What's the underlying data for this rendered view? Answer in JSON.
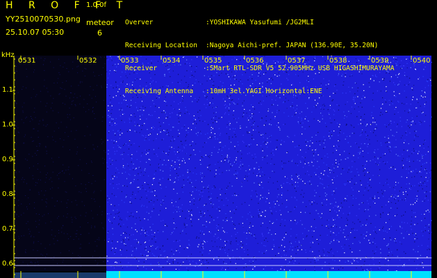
{
  "header": {
    "title": "H R O F F T",
    "version": "1.0.0f",
    "filename": "YY2510070530.png",
    "datetime": "25.10.07 05:30",
    "meteor_label": "meteor",
    "meteor_count": "6"
  },
  "station_info": [
    {
      "key": "Overver",
      "value": ":YOSHIKAWA Yasufumi /JG2MLI"
    },
    {
      "key": "Receiving Location",
      "value": ":Nagoya Aichi-pref. JAPAN (136.90E, 35.20N)"
    },
    {
      "key": "Receiver",
      "value": ":SMart RTL-SDR V5 52.905MHz USB HIGASHIMURAYAMA"
    },
    {
      "key": "Receiving Antenna",
      "value": ":10mH 3el.YAGI Horizontal:ENE"
    }
  ],
  "axis": {
    "y_unit": "kHz",
    "y_ticks": [
      "1.1",
      "1.0",
      "0.9",
      "0.8",
      "0.7",
      "0.6"
    ],
    "x_ticks": [
      "0531",
      "0532",
      "0533",
      "0534",
      "0535",
      "0536",
      "0537",
      "0538",
      "0539",
      "0540"
    ]
  },
  "colors": {
    "text": "#ffff00",
    "background": "#000000",
    "noise_high": "#1e1ed8",
    "noise_low": "#050518",
    "bottom_band": "#00e0ff"
  }
}
